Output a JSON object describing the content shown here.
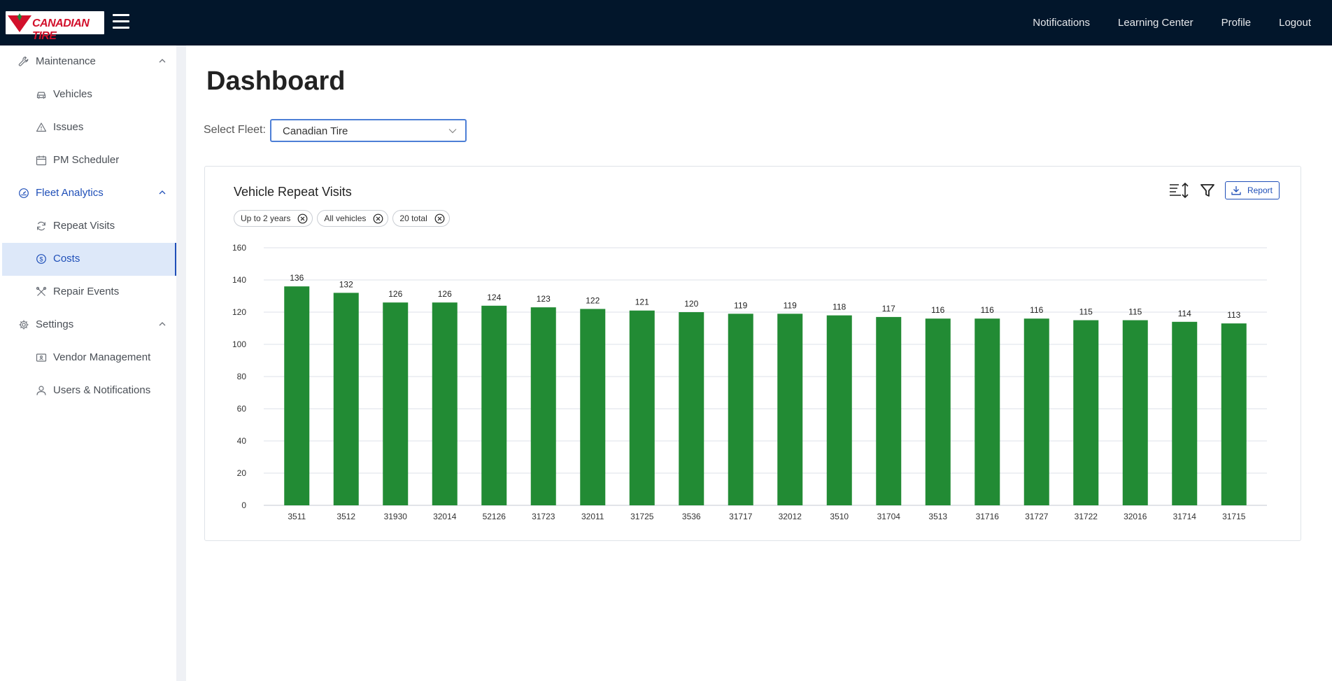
{
  "header": {
    "logo_text": "CANADIAN TIRE",
    "nav": [
      "Notifications",
      "Learning Center",
      "Profile",
      "Logout"
    ]
  },
  "sidebar": {
    "groups": [
      {
        "label": "Maintenance",
        "icon": "wrench-icon",
        "items": [
          {
            "label": "Vehicles",
            "icon": "car-icon"
          },
          {
            "label": "Issues",
            "icon": "warning-icon"
          },
          {
            "label": "PM Scheduler",
            "icon": "calendar-icon"
          }
        ]
      },
      {
        "label": "Fleet Analytics",
        "icon": "gauge-icon",
        "items": [
          {
            "label": "Repeat Visits",
            "icon": "refresh-icon"
          },
          {
            "label": "Costs",
            "icon": "dollar-icon"
          },
          {
            "label": "Repair Events",
            "icon": "tools-icon"
          }
        ]
      },
      {
        "label": "Settings",
        "icon": "gear-icon",
        "items": [
          {
            "label": "Vendor Management",
            "icon": "id-card-icon"
          },
          {
            "label": "Users & Notifications",
            "icon": "user-icon"
          }
        ]
      }
    ],
    "selected_item": "Costs",
    "active_group": "Fleet Analytics"
  },
  "main": {
    "title": "Dashboard",
    "fleet_label": "Select Fleet:",
    "fleet_value": "Canadian Tire"
  },
  "card": {
    "title": "Vehicle Repeat Visits",
    "report_label": "Report",
    "chips": [
      "Up to 2 years",
      "All vehicles",
      "20 total"
    ]
  },
  "colors": {
    "topbar": "#02162b",
    "bar": "#228b34",
    "accent": "#1f4fb8",
    "selected_bg": "#dde8f9"
  },
  "chart_data": {
    "type": "bar",
    "title": "Vehicle Repeat Visits",
    "xlabel": "",
    "ylabel": "",
    "ylim": [
      0,
      160
    ],
    "yticks": [
      0,
      20,
      40,
      60,
      80,
      100,
      120,
      140,
      160
    ],
    "grid": true,
    "categories": [
      "3511",
      "3512",
      "31930",
      "32014",
      "52126",
      "31723",
      "32011",
      "31725",
      "3536",
      "31717",
      "32012",
      "3510",
      "31704",
      "3513",
      "31716",
      "31727",
      "31722",
      "32016",
      "31714",
      "31715"
    ],
    "values": [
      136,
      132,
      126,
      126,
      124,
      123,
      122,
      121,
      120,
      119,
      119,
      118,
      117,
      116,
      116,
      116,
      115,
      115,
      114,
      113
    ]
  }
}
